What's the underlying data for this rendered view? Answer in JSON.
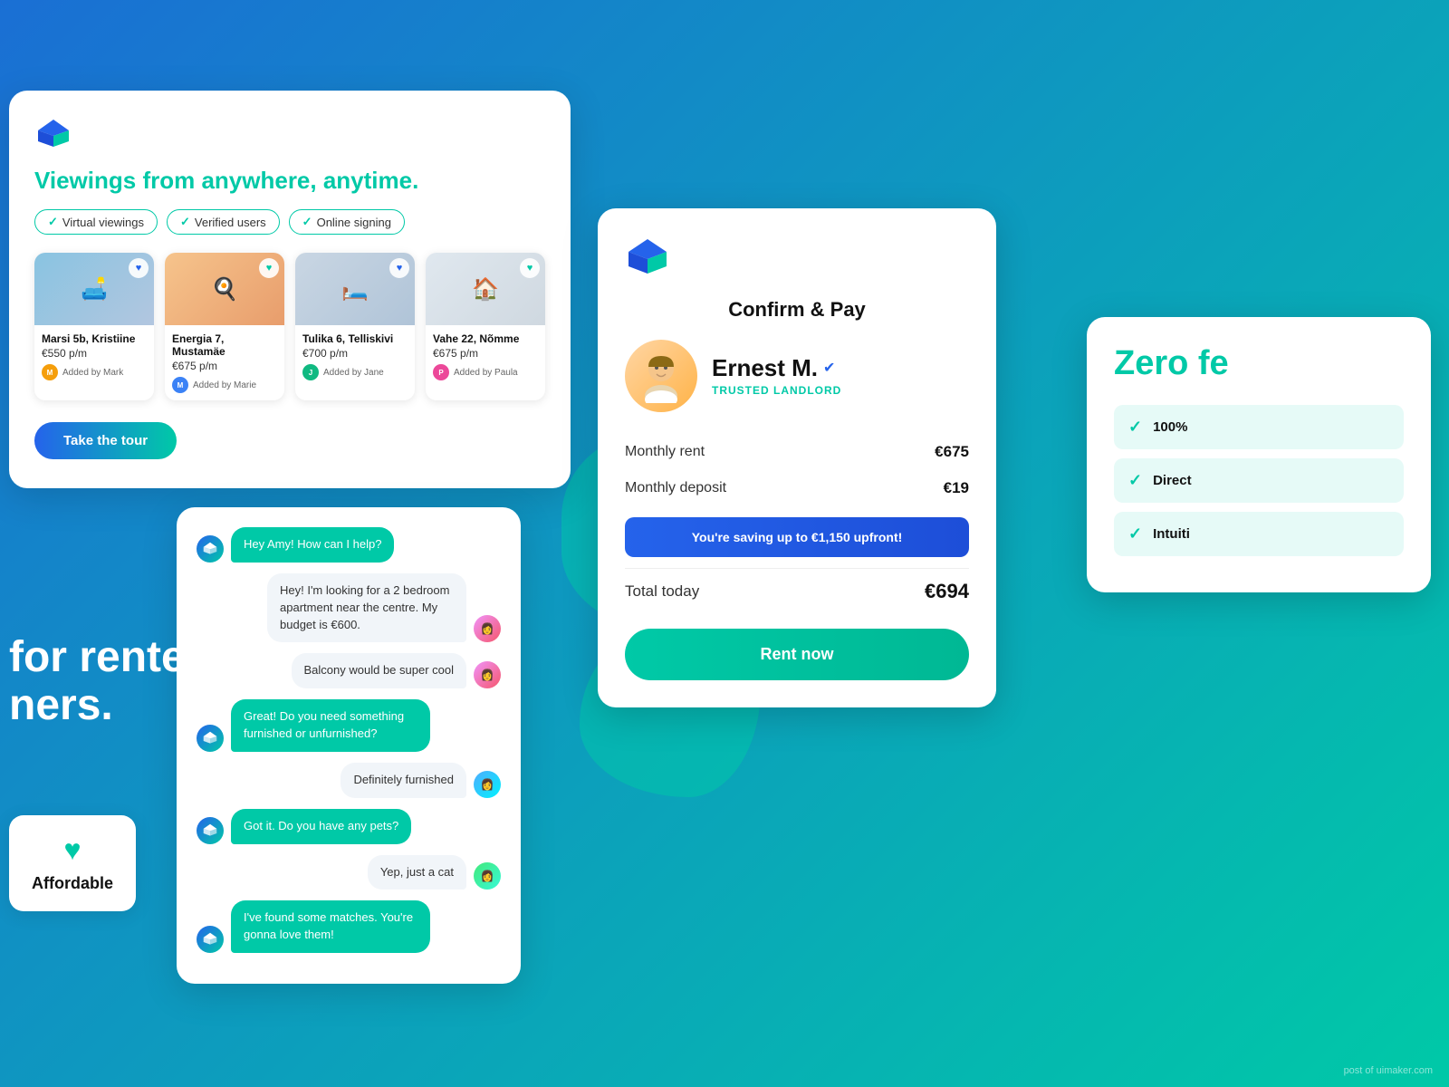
{
  "background": {
    "gradient_start": "#1a6fd4",
    "gradient_end": "#00c9a7"
  },
  "card_viewings": {
    "title_part1": "Viewings from anywhere, ",
    "title_highlight": "anytime.",
    "badges": [
      {
        "label": "Virtual viewings"
      },
      {
        "label": "Verified users"
      },
      {
        "label": "Online signing"
      }
    ],
    "properties": [
      {
        "name": "Marsi 5b, Kristiine",
        "price": "€550 p/m",
        "agent": "Added by Mark",
        "agent_key": "mark",
        "heart_color": "blue"
      },
      {
        "name": "Energia 7, Mustamäe",
        "price": "€675 p/m",
        "agent": "Added by Marie",
        "agent_key": "marie",
        "heart_color": "teal"
      },
      {
        "name": "Tulika 6, Telliskivi",
        "price": "€700 p/m",
        "agent": "Added by Jane",
        "agent_key": "jane",
        "heart_color": "blue"
      },
      {
        "name": "Vahe 22, Nõmme",
        "price": "€675 p/m",
        "agent": "Added by Paula",
        "agent_key": "paula",
        "heart_color": "teal"
      }
    ],
    "cta_label": "Take the tour"
  },
  "card_confirm": {
    "title": "Confirm & Pay",
    "landlord_name": "Ernest M.",
    "landlord_verified_label": "✓",
    "landlord_role": "TRUSTED LANDLORD",
    "monthly_rent_label": "Monthly rent",
    "monthly_rent_value": "€675",
    "monthly_deposit_label": "Monthly deposit",
    "monthly_deposit_value": "€19",
    "saving_banner": "You're saving up to €1,150 upfront!",
    "total_label": "Total today",
    "total_value": "€694",
    "rent_btn_label": "Rent now"
  },
  "card_chat": {
    "messages": [
      {
        "type": "bot",
        "text": "Hey Amy! How can I help?"
      },
      {
        "type": "user",
        "text": "Hey! I'm looking for a 2 bedroom apartment near the centre. My budget is €600.",
        "avatar": "amy"
      },
      {
        "type": "user",
        "text": "Balcony would be super cool",
        "avatar": "amy"
      },
      {
        "type": "bot",
        "text": "Great! Do you need something furnished or unfurnished?"
      },
      {
        "type": "user",
        "text": "Definitely furnished",
        "avatar": "amy2"
      },
      {
        "type": "bot",
        "text": "Got it. Do you have any pets?"
      },
      {
        "type": "user",
        "text": "Yep, just a cat",
        "avatar": "amy3"
      },
      {
        "type": "bot",
        "text": "I've found some matches. You're gonna love them!"
      }
    ]
  },
  "card_zero": {
    "title": "Zero fe",
    "items": [
      {
        "label": "100%"
      },
      {
        "label": "Direct"
      },
      {
        "label": "Intuiti"
      }
    ]
  },
  "left_text": {
    "line1": "for renters",
    "line2": "ners."
  },
  "affordable": {
    "label": "Affordable"
  },
  "watermark": "post of uimaker.com"
}
